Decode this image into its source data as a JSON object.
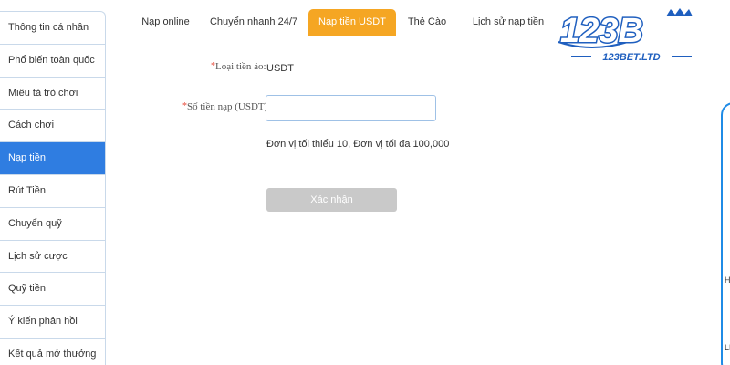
{
  "sidebar": {
    "items": [
      {
        "label": "Thông tin cá nhân",
        "active": false
      },
      {
        "label": "Phổ biến toàn quốc",
        "active": false
      },
      {
        "label": "Miêu tả trò chơi",
        "active": false
      },
      {
        "label": "Cách chơi",
        "active": false
      },
      {
        "label": "Nạp tiền",
        "active": true
      },
      {
        "label": "Rút Tiền",
        "active": false
      },
      {
        "label": "Chuyển quỹ",
        "active": false
      },
      {
        "label": "Lịch sử cược",
        "active": false
      },
      {
        "label": "Quỹ tiền",
        "active": false
      },
      {
        "label": "Ý kiến phản hồi",
        "active": false
      },
      {
        "label": "Kết quả mở thưởng",
        "active": false
      }
    ]
  },
  "tabs": [
    {
      "label": "Nạp online",
      "active": false
    },
    {
      "label": "Chuyển nhanh 24/7",
      "active": false
    },
    {
      "label": "Nạp tiền USDT",
      "active": true
    },
    {
      "label": "Thẻ Cào",
      "active": false
    },
    {
      "label": "Lịch sử nạp tiền",
      "active": false
    }
  ],
  "logo": {
    "mark": "123B",
    "domain": "123BET.LTD"
  },
  "form": {
    "required_mark": "*",
    "currency_label": "Loại tiền ảo:",
    "currency_value": "USDT",
    "amount_label": "Số tiền nạp (USDT):",
    "amount_value": "",
    "amount_placeholder": "",
    "hint": "Đơn vị tối thiểu 10, Đơn vị tối đa 100,000",
    "submit_label": "Xác nhận"
  },
  "edge": {
    "text_1": "H",
    "text_2": "LH"
  },
  "colors": {
    "accent_blue": "#2f7de1",
    "tab_active": "#f5a623",
    "button_disabled": "#c9c9c9",
    "required": "#e74c3c",
    "logo_blue": "#1f5fbf"
  }
}
